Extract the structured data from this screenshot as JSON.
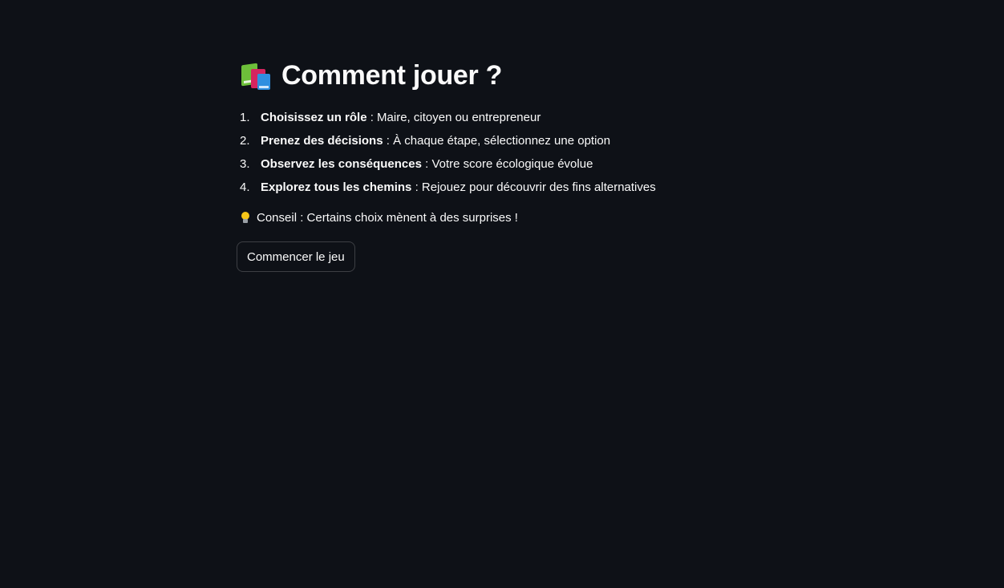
{
  "page": {
    "title": "Comment jouer ?",
    "title_icon": "books-icon"
  },
  "steps": [
    {
      "number": "1.",
      "bold": "Choisissez un rôle",
      "text": " : Maire, citoyen ou entrepreneur"
    },
    {
      "number": "2.",
      "bold": "Prenez des décisions",
      "text": " : À chaque étape, sélectionnez une option"
    },
    {
      "number": "3.",
      "bold": "Observez les conséquences",
      "text": " : Votre score écologique évolue"
    },
    {
      "number": "4.",
      "bold": "Explorez tous les chemins",
      "text": " : Rejouez pour découvrir des fins alternatives"
    }
  ],
  "tip": {
    "icon": "lightbulb-icon",
    "text": "Conseil : Certains choix mènent à des surprises !"
  },
  "start_button": {
    "label": "Commencer le jeu"
  },
  "colors": {
    "background": "#0e1117",
    "text": "#fafafa"
  }
}
